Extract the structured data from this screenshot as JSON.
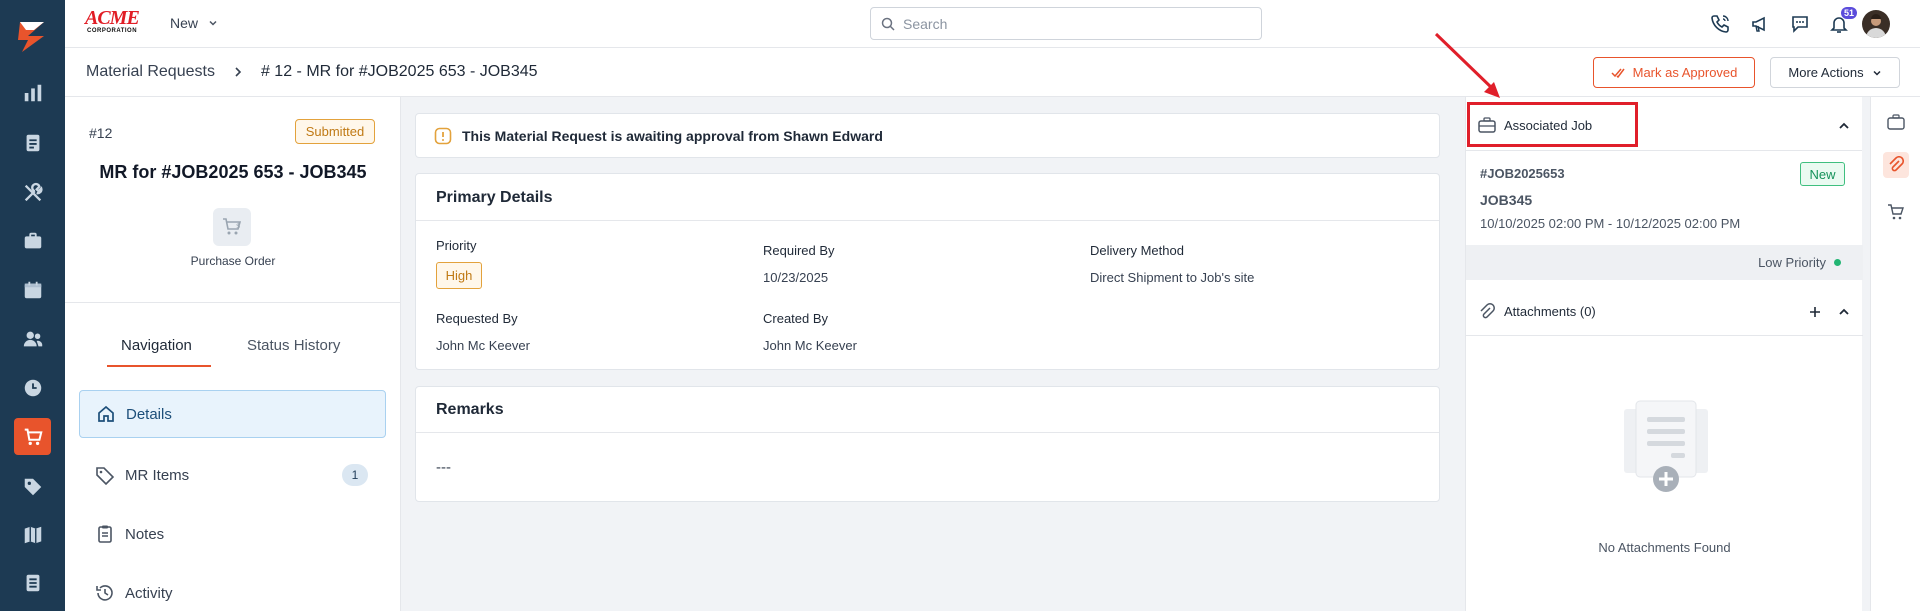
{
  "colors": {
    "rail": "#1d3a53",
    "accent": "#e8542c",
    "highlight": "#e01f2a"
  },
  "topbar": {
    "brand_top": "ACME",
    "brand_bottom": "CORPORATION",
    "new_label": "New",
    "search_placeholder": "Search",
    "notifications_count": "51"
  },
  "breadcrumb": {
    "parent": "Material Requests",
    "current": "# 12 - MR for #JOB2025 653 - JOB345"
  },
  "actions": {
    "approve_label": "Mark as Approved",
    "more_label": "More Actions"
  },
  "summary": {
    "number": "#12",
    "status": "Submitted",
    "title": "MR for #JOB2025 653 - JOB345",
    "po_label": "Purchase Order"
  },
  "tabs": {
    "navigation": "Navigation",
    "status_history": "Status History"
  },
  "nav_items": [
    {
      "label": "Details"
    },
    {
      "label": "MR Items",
      "count": "1"
    },
    {
      "label": "Notes"
    },
    {
      "label": "Activity"
    }
  ],
  "alert": {
    "text": "This Material Request is awaiting approval from Shawn Edward"
  },
  "primary": {
    "title": "Primary Details",
    "priority_label": "Priority",
    "priority_value": "High",
    "required_by_label": "Required By",
    "required_by_value": "10/23/2025",
    "delivery_label": "Delivery Method",
    "delivery_value": "Direct Shipment to Job's site",
    "requested_by_label": "Requested By",
    "requested_by_value": "John Mc Keever",
    "created_by_label": "Created By",
    "created_by_value": "John Mc Keever"
  },
  "remarks": {
    "title": "Remarks",
    "value": "---"
  },
  "associated_job": {
    "title": "Associated Job",
    "job_id": "#JOB2025653",
    "job_name": "JOB345",
    "dates": "10/10/2025 02:00 PM - 10/12/2025 02:00 PM",
    "status": "New",
    "priority": "Low Priority"
  },
  "attachments": {
    "title": "Attachments (0)",
    "empty": "No Attachments Found"
  }
}
